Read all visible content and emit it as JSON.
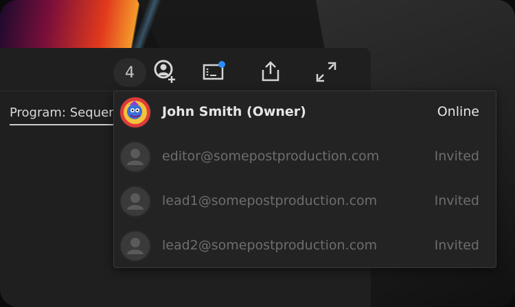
{
  "toolbar": {
    "collaborator_count": "4",
    "icons": [
      "add-collaborator-icon",
      "panel-notification-icon",
      "share-export-icon",
      "fullscreen-expand-icon"
    ]
  },
  "program_tab": {
    "label": "Program: Sequence"
  },
  "members": [
    {
      "name": "John Smith (Owner)",
      "status": "Online",
      "avatar": "custom-avatar"
    },
    {
      "name": "editor@somepostproduction.com",
      "status": "Invited",
      "avatar": "default-user"
    },
    {
      "name": "lead1@somepostproduction.com",
      "status": "Invited",
      "avatar": "default-user"
    },
    {
      "name": "lead2@somepostproduction.com",
      "status": "Invited",
      "avatar": "default-user"
    }
  ],
  "colors": {
    "notification_dot": "#2d8cff",
    "owner_text": "#e6e6e6",
    "invited_text": "#6e6e6e"
  }
}
